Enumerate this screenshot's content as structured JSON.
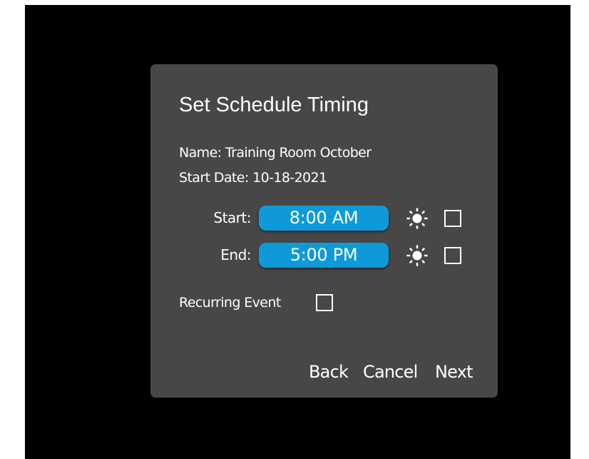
{
  "dialog": {
    "title": "Set Schedule Timing",
    "name_line": "Name: Training Room October",
    "start_date_line": "Start Date: 10-18-2021",
    "start": {
      "label": "Start:",
      "time": "8:00 AM",
      "icon": "sun-icon",
      "checked": false
    },
    "end": {
      "label": "End:",
      "time": "5:00 PM",
      "icon": "sun-icon",
      "checked": false
    },
    "recurring": {
      "label": "Recurring Event",
      "checked": false
    },
    "buttons": {
      "back": "Back",
      "cancel": "Cancel",
      "next": "Next"
    }
  },
  "colors": {
    "background": "#000000",
    "dialog": "#474747",
    "accent": "#0e9ad8",
    "text": "#ffffff"
  }
}
